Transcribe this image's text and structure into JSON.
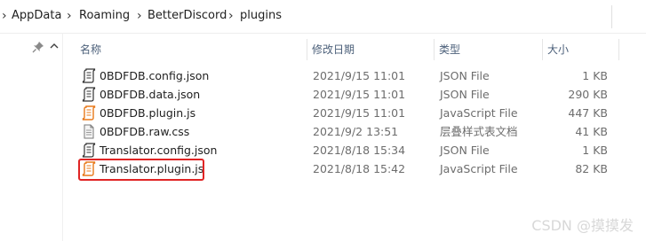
{
  "breadcrumb": {
    "items": [
      "AppData",
      "Roaming",
      "BetterDiscord",
      "plugins"
    ]
  },
  "columns": {
    "name": "名称",
    "date": "修改日期",
    "type": "类型",
    "size": "大小"
  },
  "files": [
    {
      "name": "0BDFDB.config.json",
      "date": "2021/9/15 11:01",
      "type": "JSON File",
      "size": "1 KB",
      "icon": "json-file-icon"
    },
    {
      "name": "0BDFDB.data.json",
      "date": "2021/9/15 11:01",
      "type": "JSON File",
      "size": "290 KB",
      "icon": "json-file-icon"
    },
    {
      "name": "0BDFDB.plugin.js",
      "date": "2021/9/15 11:01",
      "type": "JavaScript File",
      "size": "447 KB",
      "icon": "javascript-file-icon"
    },
    {
      "name": "0BDFDB.raw.css",
      "date": "2021/9/2 13:51",
      "type": "层叠样式表文档",
      "size": "41 KB",
      "icon": "css-file-icon"
    },
    {
      "name": "Translator.config.json",
      "date": "2021/8/18 15:34",
      "type": "JSON File",
      "size": "1 KB",
      "icon": "json-file-icon"
    },
    {
      "name": "Translator.plugin.js",
      "date": "2021/8/18 15:42",
      "type": "JavaScript File",
      "size": "82 KB",
      "icon": "javascript-file-icon"
    }
  ],
  "highlighted_file": "Translator.plugin.js",
  "colors": {
    "highlight_border": "#e02424",
    "header_text": "#4c607a",
    "js_icon": "#e8791a",
    "json_icon": "#333333"
  },
  "watermark": "CSDN @摸摸发"
}
